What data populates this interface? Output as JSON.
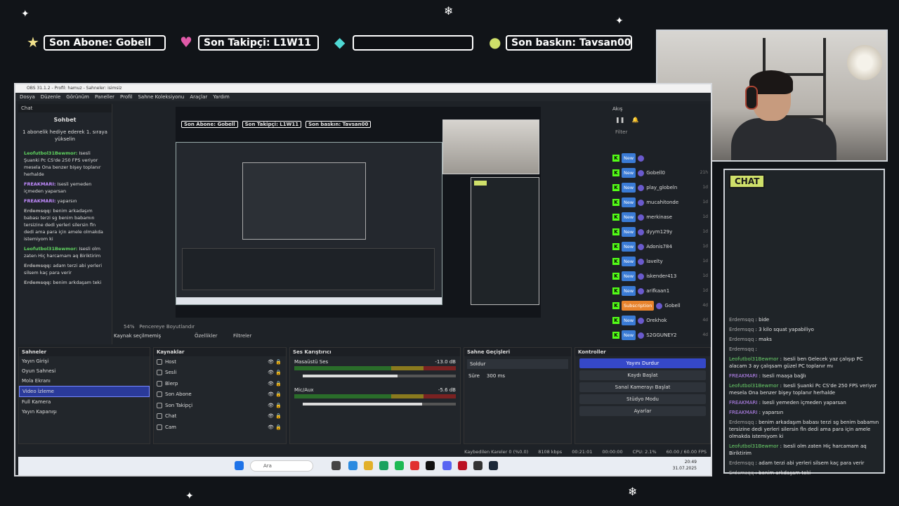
{
  "overlay": {
    "sub_label": "Son Abone: Gobell",
    "follower_label": "Son Takipçi: L1W11",
    "empty_label": "",
    "raid_label": "Son baskın: Tavsan00",
    "chat_tag": "CHAT",
    "colors": {
      "accent_green": "#cfe06a",
      "heart": "#e05aa8",
      "diamond": "#4fd9d4"
    }
  },
  "overlay_chat": [
    {
      "user": "Erdemsqq",
      "style": "w",
      "text": "bide"
    },
    {
      "user": "Erdemsqq",
      "style": "w",
      "text": "3 kilo squat yapabiliyo"
    },
    {
      "user": "Erdemsqq",
      "style": "w",
      "text": "maks"
    },
    {
      "user": "Erdemsqq",
      "style": "w",
      "text": ""
    },
    {
      "user": "Leofutbol31Bewmor",
      "style": "g",
      "text": "Isesli ben Gelecek yaz çalışıp PC alacam 3 ay çalışsam güzel PC toplanır mı"
    },
    {
      "user": "FREAKMARI",
      "style": "p",
      "text": "Isesli maaşa bağlı"
    },
    {
      "user": "Leofutbol31Bewmor",
      "style": "g",
      "text": "Isesli Şuanki Pc CS'de 250 FPS veriyor mesela Ona benzer bişey toplanır herhalde"
    },
    {
      "user": "FREAKMARI",
      "style": "p",
      "text": "Isesli yemeden içmeden yaparsan"
    },
    {
      "user": "FREAKMARI",
      "style": "p",
      "text": "yaparsın"
    },
    {
      "user": "Erdemsqq",
      "style": "w",
      "text": "benim arkadaşım babası terzi sg benim babamın tersizine dedi yerleri silersin fln dedi ama para için amele olmakda istemiyom ki"
    },
    {
      "user": "Leofutbol31Bewmor",
      "style": "g",
      "text": "Isesli olm zaten Hiç harcamam aq Biriktirim"
    },
    {
      "user": "Erdemsqq",
      "style": "w",
      "text": "adam terzi abi yerleri silsem kaç para verir"
    },
    {
      "user": "Erdemsqq",
      "style": "w",
      "text": "benim arkdaşam teki"
    }
  ],
  "obs": {
    "title": "OBS 31.1.2 - Profil: hamuz - Sahneler: isimsiz",
    "menu": [
      "Dosya",
      "Düzenle",
      "Görünüm",
      "Paneller",
      "Profil",
      "Sahne Koleksiyonu",
      "Araçlar",
      "Yardım"
    ],
    "chat_dock_title": "Chat",
    "sohbet": "Sohbet",
    "gift_text": "1 abonelik hediye ederek 1. sıraya yükselin",
    "dock_msgs": [
      {
        "user": "Leofutbol31Bewmor:",
        "cls": "g",
        "text": "Isesli Şuanki Pc CS'de 250 FPS veriyor mesela Ona benzer bişey toplanır herhalde"
      },
      {
        "user": "FREAKMARI:",
        "cls": "p",
        "text": "Isesli yemeden içmeden yaparsan"
      },
      {
        "user": "FREAKMARI:",
        "cls": "p",
        "text": "yaparsın"
      },
      {
        "user": "Erdemsqq:",
        "cls": "w",
        "text": "benim arkadaşım babası terzi sg benim babamın tersizine dedi yerleri silersin fln dedi ama para için amele olmakda istemiyom ki"
      },
      {
        "user": "Leofutbol31Bewmor:",
        "cls": "g",
        "text": "Isesli olm zaten Hiç harcamam aq Biriktirim"
      },
      {
        "user": "Erdemsqq:",
        "cls": "w",
        "text": "adam terzi abi yerleri silsem kaç para verir"
      },
      {
        "user": "Erdemsqq:",
        "cls": "w",
        "text": "benim arkdaşam teki"
      }
    ],
    "akis_title": "Akış",
    "filter": "Filter",
    "feed": [
      {
        "tag": "New",
        "name": "",
        "time": ""
      },
      {
        "tag": "New",
        "name": "Gobell0",
        "time": "21h"
      },
      {
        "tag": "New",
        "name": "play_globeln",
        "time": "1d"
      },
      {
        "tag": "New",
        "name": "mucahitonde",
        "time": "1d"
      },
      {
        "tag": "New",
        "name": "merkinase",
        "time": "1d"
      },
      {
        "tag": "New",
        "name": "dyym129y",
        "time": "1d"
      },
      {
        "tag": "New",
        "name": "Adonis784",
        "time": "1d"
      },
      {
        "tag": "New",
        "name": "lavelty",
        "time": "1d"
      },
      {
        "tag": "New",
        "name": "iskender413",
        "time": "1d"
      },
      {
        "tag": "New",
        "name": "arifkaan1",
        "time": "1d"
      },
      {
        "tag": "Subscription",
        "name": "Gobell",
        "time": "4d"
      },
      {
        "tag": "New",
        "name": "Orekhok",
        "time": "4d"
      },
      {
        "tag": "New",
        "name": "S2GGUNEY2",
        "time": "4d"
      }
    ],
    "no_source": "Kaynak seçilmemiş",
    "props": "Özellikler",
    "filters": "Filtreler",
    "zoom": "54%",
    "fit": "Pencereye Boyutlandır",
    "scenes_title": "Sahneler",
    "scenes": [
      "Yayın Girişi",
      "Oyun Sahnesi",
      "Mola Ekranı",
      "Video İzleme",
      "Full Kamera",
      "Yayın Kapanışı"
    ],
    "selected_scene": 3,
    "sources_title": "Kaynaklar",
    "sources": [
      "Host",
      "Sesli",
      "Blerp",
      "Son Abone",
      "Son Takipçi",
      "Chat",
      "Cam"
    ],
    "mixer_title": "Ses Karıştırıcı",
    "mixer": [
      {
        "name": "Masaüstü Ses",
        "db": "-13.0 dB",
        "level": 0.62
      },
      {
        "name": "Mic/Aux",
        "db": "-5.6 dB",
        "level": 0.78
      }
    ],
    "transitions_title": "Sahne Geçişleri",
    "transition": "Soldur",
    "duration_label": "Süre",
    "duration": "300 ms",
    "controls_title": "Kontroller",
    "controls": [
      "Yayını Durdur",
      "Kaydı Başlat",
      "Sanal Kamerayı Başlat",
      "Stüdyo Modu",
      "Ayarlar"
    ],
    "status": {
      "frames": "Kaybedilen Kareler 0 (%0.0)",
      "kbps": "8108 kbps",
      "live": "00:21:01",
      "rec": "00:00:00",
      "cpu": "CPU: 2.1%",
      "fps": "60.00 / 60.00 FPS"
    },
    "search": "Ara",
    "clock_time": "20:49",
    "clock_date": "31.07.2025"
  }
}
